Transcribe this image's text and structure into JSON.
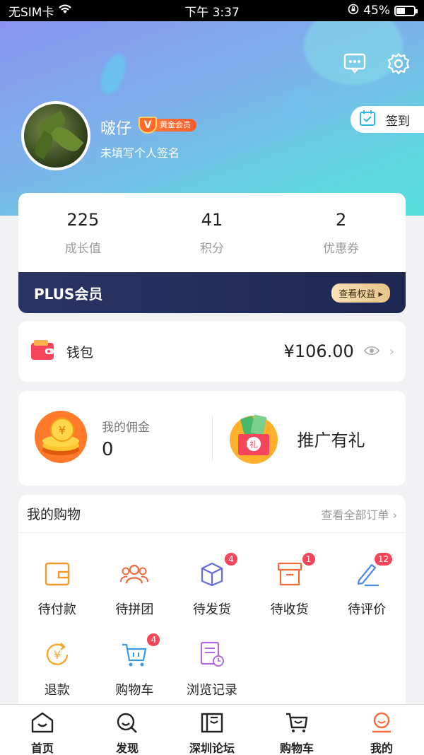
{
  "status_bar": {
    "carrier": "无SIM卡",
    "time": "下午 3:37",
    "battery": "45%"
  },
  "profile": {
    "username": "啵仔",
    "vip_letter": "V",
    "vip_level": "黄金会员",
    "signature": "未填写个人签名",
    "checkin_label": "签到"
  },
  "stats": [
    {
      "value": "225",
      "label": "成长值"
    },
    {
      "value": "41",
      "label": "积分"
    },
    {
      "value": "2",
      "label": "优惠券"
    }
  ],
  "plus": {
    "title": "PLUS会员",
    "button": "查看权益 ▸"
  },
  "wallet": {
    "label": "钱包",
    "amount": "¥106.00"
  },
  "promo": {
    "commission_label": "我的佣金",
    "commission_value": "0",
    "promo_title": "推广有礼"
  },
  "shopping": {
    "title": "我的购物",
    "view_all": "查看全部订单",
    "items": [
      {
        "label": "待付款",
        "icon": "wallet-icon",
        "badge": ""
      },
      {
        "label": "待拼团",
        "icon": "group-icon",
        "badge": ""
      },
      {
        "label": "待发货",
        "icon": "box-icon",
        "badge": "4"
      },
      {
        "label": "待收货",
        "icon": "receive-icon",
        "badge": "1"
      },
      {
        "label": "待评价",
        "icon": "pen-icon",
        "badge": "12"
      },
      {
        "label": "退款",
        "icon": "refund-icon",
        "badge": ""
      },
      {
        "label": "购物车",
        "icon": "cart-icon",
        "badge": "4"
      },
      {
        "label": "浏览记录",
        "icon": "history-icon",
        "badge": ""
      }
    ]
  },
  "tabbar": [
    {
      "label": "首页",
      "icon": "home-icon"
    },
    {
      "label": "发现",
      "icon": "discover-icon"
    },
    {
      "label": "深圳论坛",
      "icon": "forum-icon"
    },
    {
      "label": "购物车",
      "icon": "cart-icon"
    },
    {
      "label": "我的",
      "icon": "profile-icon",
      "active": true
    }
  ],
  "colors": {
    "accent": "#f5455a",
    "active_tab": "#ff6a3a",
    "hero_start": "#8a93ef",
    "hero_end": "#59dcdc"
  }
}
